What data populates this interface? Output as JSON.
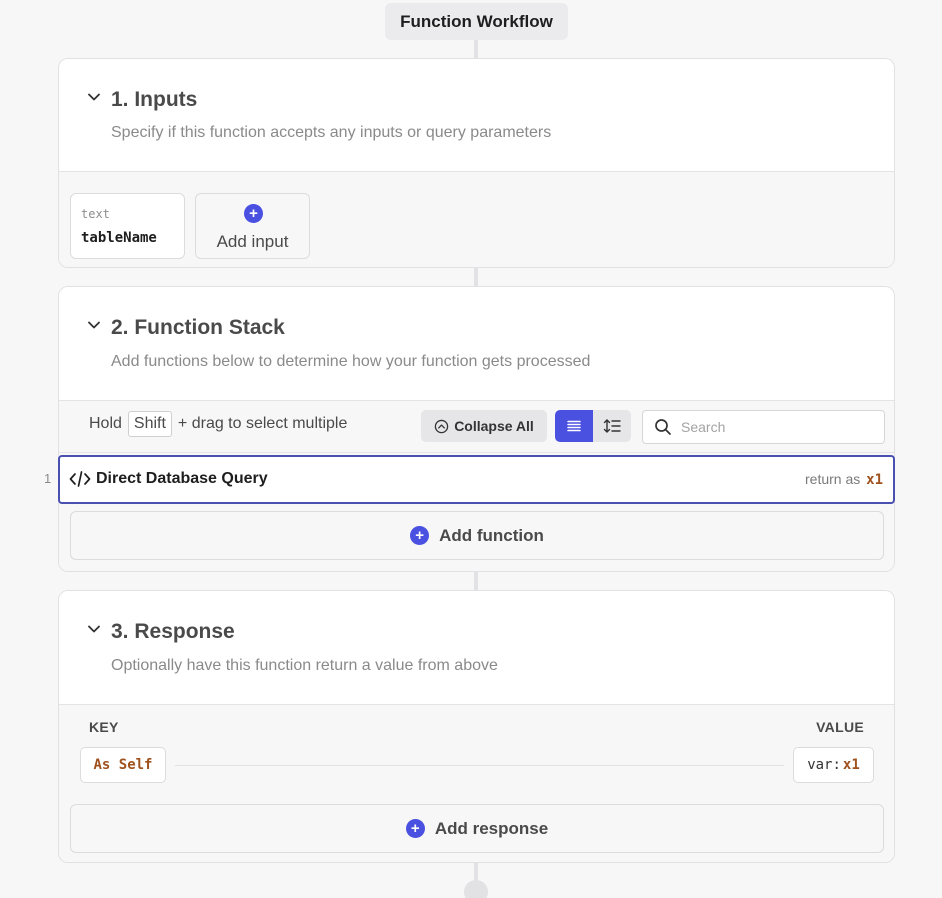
{
  "workflow": {
    "title": "Function Workflow"
  },
  "inputs_section": {
    "title": "1. Inputs",
    "subtitle": "Specify if this function accepts any inputs or query parameters",
    "input": {
      "type": "text",
      "name": "tableName"
    },
    "add_label": "Add input"
  },
  "stack_section": {
    "title": "2. Function Stack",
    "subtitle": "Add functions below to determine how your function gets processed",
    "hint_prefix": "Hold",
    "hint_key": "Shift",
    "hint_suffix": "+ drag to select multiple",
    "collapse_label": "Collapse All",
    "search_placeholder": "Search",
    "functions": [
      {
        "line": "1",
        "name": "Direct Database Query",
        "return_prefix": "return as",
        "return_var": "x1"
      }
    ],
    "add_label": "Add function"
  },
  "response_section": {
    "title": "3. Response",
    "subtitle": "Optionally have this function return a value from above",
    "key_header": "KEY",
    "value_header": "VALUE",
    "row": {
      "key": "As Self",
      "value_prefix": "var:",
      "value_var": "x1"
    },
    "add_label": "Add response"
  },
  "colors": {
    "accent": "#4a50e0",
    "variable": "#a0521e"
  },
  "icons": [
    "chevron-down-icon",
    "plus-icon",
    "code-icon",
    "chevron-up-circle-icon",
    "list-icon",
    "sort-icon",
    "search-icon"
  ]
}
